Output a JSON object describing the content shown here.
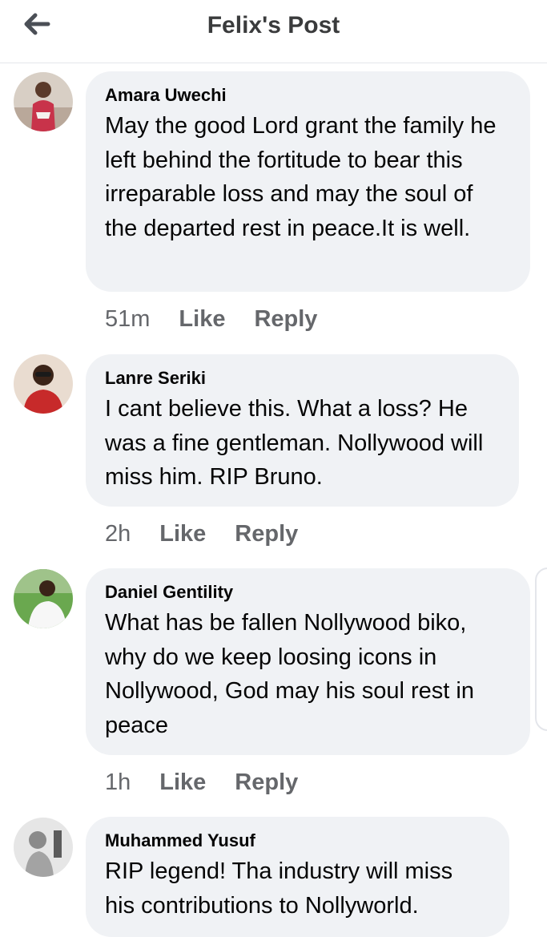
{
  "header": {
    "title": "Felix's Post",
    "back_icon": "arrow-left-icon"
  },
  "comments": [
    {
      "author": "Amara Uwechi",
      "text": "May the good Lord grant the family he left behind the fortitude to bear this irreparable loss and may the soul of the departed rest in peace.It is well.",
      "time": "51m",
      "like": "Like",
      "reply": "Reply"
    },
    {
      "author": "Lanre Seriki",
      "text": "I cant believe this. What a loss? He was a fine gentleman. Nollywood will miss him. RIP Bruno.",
      "time": "2h",
      "like": "Like",
      "reply": "Reply"
    },
    {
      "author": "Daniel Gentility",
      "text": "What has be fallen Nollywood biko, why do we keep loosing icons in Nollywood, God may his soul rest in peace",
      "time": "1h",
      "like": "Like",
      "reply": "Reply"
    },
    {
      "author": "Muhammed Yusuf",
      "text": "RIP legend! Tha industry will miss his contributions to Nollyworld.",
      "time": "",
      "like": "",
      "reply": ""
    }
  ]
}
